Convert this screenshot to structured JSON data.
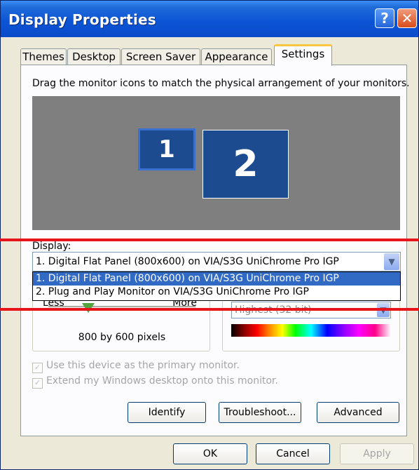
{
  "window": {
    "title": "Display Properties",
    "help_label": "?",
    "close_label": "✕"
  },
  "tabs": [
    {
      "label": "Themes"
    },
    {
      "label": "Desktop"
    },
    {
      "label": "Screen Saver"
    },
    {
      "label": "Appearance"
    },
    {
      "label": "Settings"
    }
  ],
  "settings": {
    "instruction": "Drag the monitor icons to match the physical arrangement of your monitors.",
    "monitors": [
      "1",
      "2"
    ],
    "display_label": "Display:",
    "display_selected": "1. Digital Flat Panel (800x600) on VIA/S3G UniChrome Pro IGP",
    "display_options": [
      "1. Digital Flat Panel (800x600) on VIA/S3G UniChrome Pro IGP",
      "2. Plug and Play Monitor on VIA/S3G UniChrome Pro IGP"
    ],
    "resolution": {
      "less": "Less",
      "more": "More",
      "value_text": "800 by 600 pixels"
    },
    "color_quality": {
      "selected": "Highest (32 bit)"
    },
    "checkboxes": [
      {
        "label": "Use this device as the primary monitor.",
        "checked": true
      },
      {
        "label": "Extend my Windows desktop onto this monitor.",
        "checked": true
      }
    ],
    "buttons": {
      "identify": "Identify",
      "troubleshoot": "Troubleshoot...",
      "advanced": "Advanced"
    }
  },
  "footer": {
    "ok": "OK",
    "cancel": "Cancel",
    "apply": "Apply"
  },
  "colors": {
    "titlebar": "#0a4bc8",
    "highlight": "#316ac5",
    "annotation_red": "#e8141c"
  },
  "icons": {
    "help": "question-mark-icon",
    "close": "close-icon",
    "dropdown": "chevron-down-icon",
    "checkbox": "checkmark-icon"
  }
}
